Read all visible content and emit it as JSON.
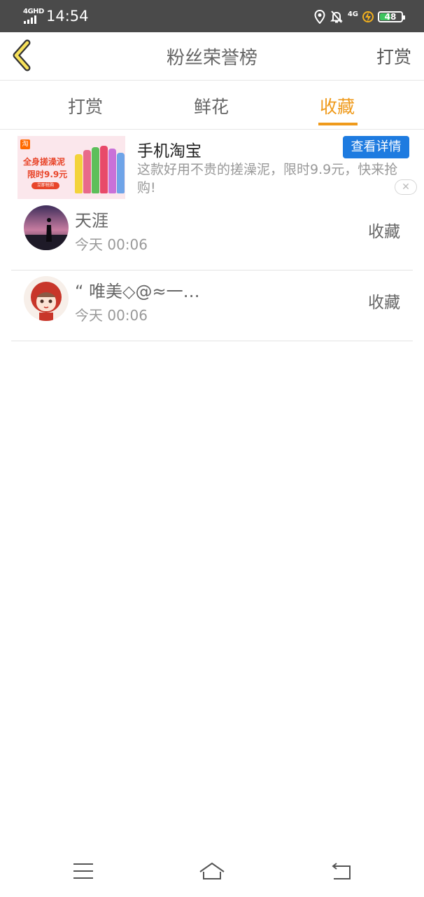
{
  "status_bar": {
    "network": "4GHD",
    "time": "14:54",
    "network_right": "4G",
    "battery": "48",
    "icons": [
      "location-icon",
      "bell-off-icon",
      "charging-icon",
      "battery-icon"
    ]
  },
  "header": {
    "title": "粉丝荣誉榜",
    "action": "打赏",
    "back_icon": "chevron-left-icon"
  },
  "tabs": [
    {
      "label": "打赏",
      "active": false
    },
    {
      "label": "鲜花",
      "active": false
    },
    {
      "label": "收藏",
      "active": true
    }
  ],
  "ad": {
    "app_name": "手机淘宝",
    "button": "查看详情",
    "description": "这款好用不贵的搓澡泥，限时9.9元，快来抢购!",
    "image_title": "全身搓澡泥",
    "image_price": "限时9.9元",
    "image_button": "立即抢购",
    "logo": "淘",
    "close": "✕"
  },
  "list": [
    {
      "name": "天涯",
      "time": "今天 00:06",
      "action": "收藏"
    },
    {
      "name": "“ 唯美◇@≈一…",
      "time": "今天 00:06",
      "action": "收藏"
    }
  ],
  "colors": {
    "accent": "#ef9a1b",
    "ad_button": "#1e7be0",
    "status_bar": "#4a4a4a"
  },
  "nav": {
    "icons": [
      "menu-icon",
      "home-icon",
      "back-icon"
    ]
  }
}
